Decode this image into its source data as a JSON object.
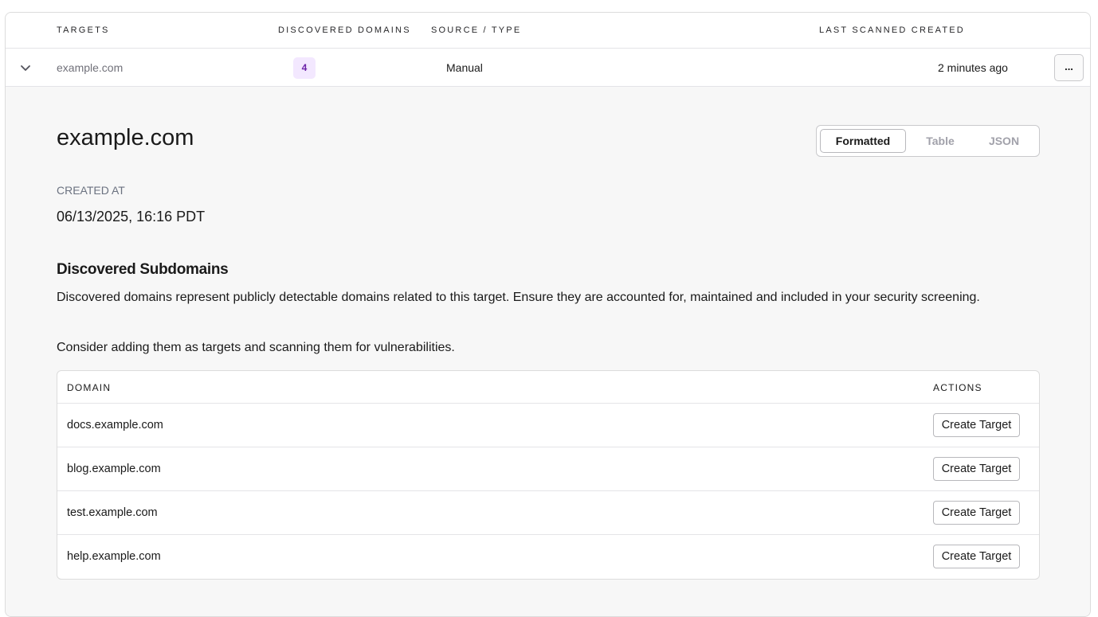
{
  "table_header": {
    "targets": "TARGETS",
    "discovered_domains": "DISCOVERED DOMAINS",
    "source_type": "SOURCE / TYPE",
    "last_scanned_created": "LAST SCANNED CREATED"
  },
  "target_row": {
    "name": "example.com",
    "discovered_count": "4",
    "source": "Manual",
    "last_scanned": "2 minutes ago",
    "menu_label": "...",
    "expand_icon": "chevron-down-icon"
  },
  "detail": {
    "title": "example.com",
    "view_tabs": [
      "Formatted",
      "Table",
      "JSON"
    ],
    "active_view": "Formatted",
    "created_at_label": "CREATED AT",
    "created_at_value": "06/13/2025, 16:16 PDT",
    "subdomains_heading": "Discovered Subdomains",
    "subdomains_description": "Discovered domains represent publicly detectable domains related to this target. Ensure they are accounted for, maintained and included in your security screening.",
    "subdomains_consider": "Consider adding them as targets and scanning them for vulnerabilities.",
    "domains_table": {
      "col_domain": "DOMAIN",
      "col_actions": "ACTIONS",
      "rows": [
        {
          "domain": "docs.example.com",
          "action": "Create Target"
        },
        {
          "domain": "blog.example.com",
          "action": "Create Target"
        },
        {
          "domain": "test.example.com",
          "action": "Create Target"
        },
        {
          "domain": "help.example.com",
          "action": "Create Target"
        }
      ]
    }
  },
  "colors": {
    "badge_bg": "#f3e8ff",
    "badge_text": "#6b21a8",
    "detail_bg": "#f7f7f7"
  }
}
